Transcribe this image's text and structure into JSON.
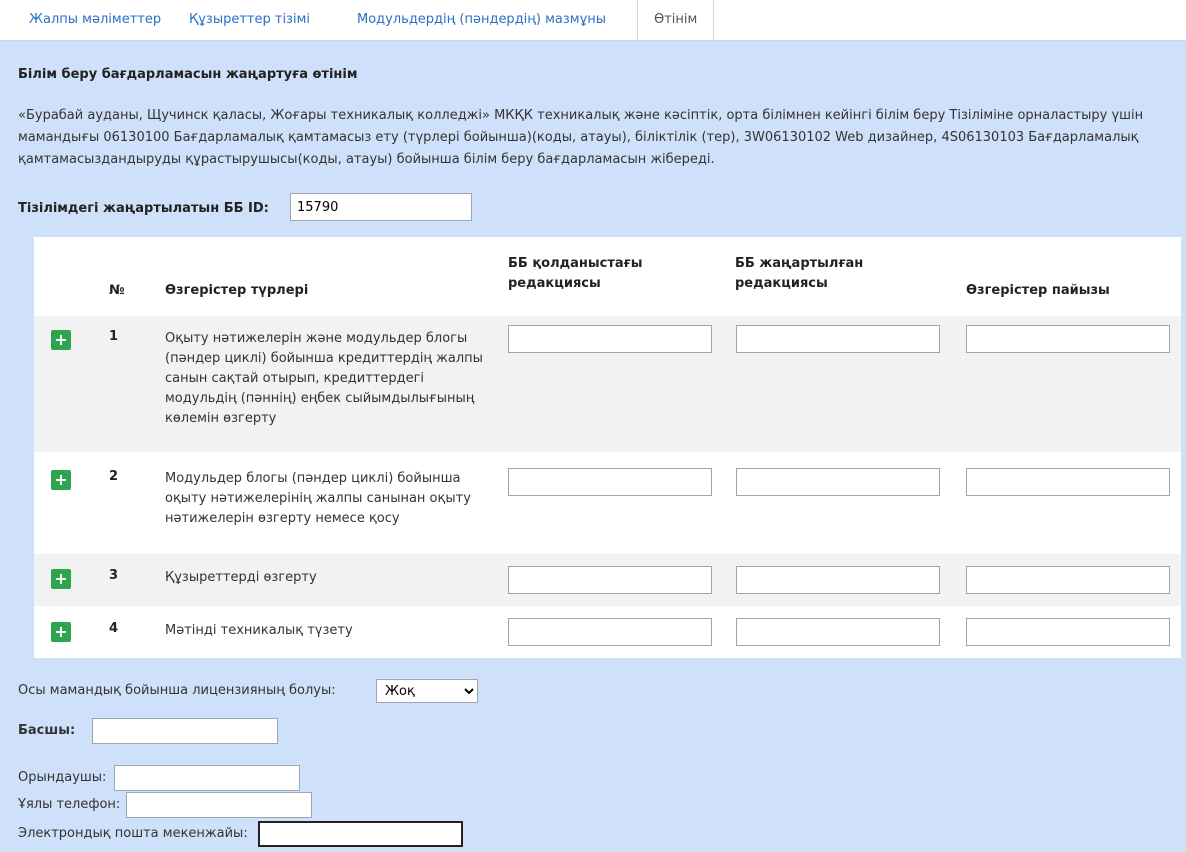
{
  "tabs": [
    {
      "label": "Жалпы мәліметтер"
    },
    {
      "label": "Құзыреттер тізімі"
    },
    {
      "label": "Модульдердің (пәндердің) мазмұны"
    },
    {
      "label": "Өтінім"
    }
  ],
  "section": {
    "title": "Білім беру бағдарламасын жаңартуға өтінім",
    "description": "«Бурабай ауданы, Щучинск қаласы, Жоғары техникалық колледжі» МКҚК техникалық және кәсіптік, орта білімнен кейінгі білім беру Тізіліміне орналастыру үшін мамандығы 06130100 Бағдарламалық қамтамасыз ету (түрлері бойынша)(коды, атауы), біліктілік (тер), 3W06130102 Web дизайнер, 4S06130103 Бағдарламалық қамтамасыздандыруды құрастырушысы(коды, атауы) бойынша білім беру бағдарламасын жібереді."
  },
  "id_field": {
    "label": "Тізілімдегі жаңартылатын ББ ID:",
    "value": "15790"
  },
  "table": {
    "headers": {
      "number": "№",
      "type": "Өзгерістер түрлері",
      "current": "ББ қолданыстағы редакциясы",
      "updated": "ББ жаңартылған редакциясы",
      "percent": "Өзгерістер пайызы"
    },
    "rows": [
      {
        "num": "1",
        "type": "Оқыту нәтижелерін және модульдер блогы (пәндер циклі) бойынша кредиттердің жалпы санын сақтай отырып, кредиттердегі модульдің (пәннің) еңбек сыйымдылығының көлемін өзгерту",
        "current": "",
        "updated": "",
        "percent": ""
      },
      {
        "num": "2",
        "type": "Модульдер блогы (пәндер циклі) бойынша оқыту нәтижелерінің жалпы санынан оқыту нәтижелерін өзгерту немесе қосу",
        "current": "",
        "updated": "",
        "percent": ""
      },
      {
        "num": "3",
        "type": "Құзыреттерді өзгерту",
        "current": "",
        "updated": "",
        "percent": ""
      },
      {
        "num": "4",
        "type": "Мәтінді техникалық түзету",
        "current": "",
        "updated": "",
        "percent": ""
      }
    ],
    "add_icon": "plus-icon",
    "add_glyph": "+"
  },
  "license": {
    "label": "Осы мамандық бойынша лицензияның болуы:",
    "selected": "Жоқ"
  },
  "form": {
    "head_label": "Басшы:",
    "head_value": "",
    "executor_label": "Орындаушы:",
    "executor_value": "",
    "phone_label": "Ұялы телефон:",
    "phone_value": "",
    "email_label": "Электрондық пошта мекенжайы:",
    "email_value": ""
  },
  "colors": {
    "background": "#cfe0fa",
    "tab_link": "#2a6fc9",
    "add_button": "#2ea44f"
  }
}
